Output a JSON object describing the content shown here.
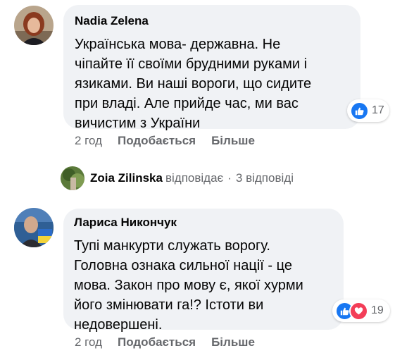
{
  "comments": [
    {
      "author": "Nadia Zelena",
      "text_lines": [
        "Українська мова- державна. Не",
        "чіпайте її своїми брудними руками і",
        "язиками. Ви наші вороги, що сидите",
        "при владі. Але прийде час, ми вас",
        "вичистим з України"
      ],
      "reactions": {
        "icons": [
          "like-icon"
        ],
        "count": "17"
      },
      "time": "2 год",
      "like_label": "Подобається",
      "more_label": "Більше"
    },
    {
      "author": "Лариса Никончук",
      "text_lines": [
        "Тупі манкурти служать ворогу.",
        "Головна ознака сильної нації - це",
        "мова. Закон про мову є, якої хурми",
        "його змінювати га!? Істоти ви",
        "недовершені."
      ],
      "reactions": {
        "icons": [
          "like-icon",
          "heart-icon"
        ],
        "count": "19"
      },
      "time": "2 год",
      "like_label": "Подобається",
      "more_label": "Більше"
    }
  ],
  "reply_summary": {
    "name": "Zoia Zilinska",
    "verb": "відповідає",
    "separator": "·",
    "count_label": "3 відповіді"
  },
  "colors": {
    "bubble": "#f0f2f5",
    "secondary_text": "#65676b",
    "like_blue": "#1877f2",
    "love_red": "#f33e58"
  }
}
